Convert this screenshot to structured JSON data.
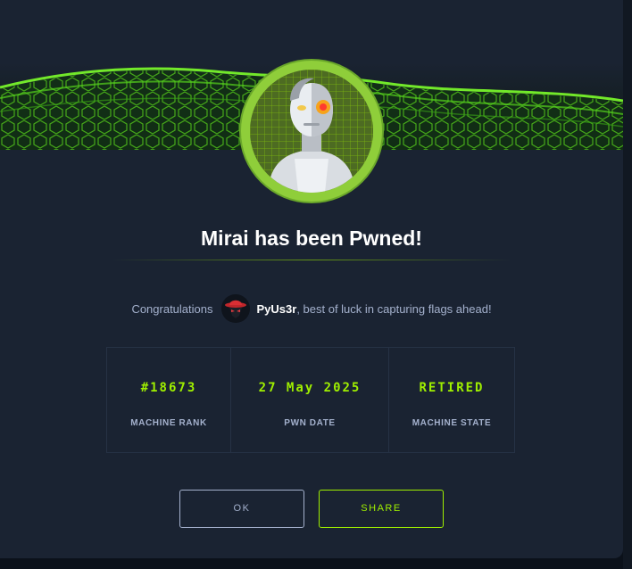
{
  "modal": {
    "title": "Mirai has been Pwned!",
    "congrats_prefix": "Congratulations",
    "username": "PyUs3r",
    "congrats_suffix": ", best of luck in capturing flags ahead!"
  },
  "stats": [
    {
      "value": "#18673",
      "label": "MACHINE RANK"
    },
    {
      "value": "27 May 2025",
      "label": "PWN DATE"
    },
    {
      "value": "RETIRED",
      "label": "MACHINE STATE"
    }
  ],
  "buttons": {
    "ok_label": "OK",
    "share_label": "SHARE"
  },
  "colors": {
    "accent": "#9fef00",
    "background": "#1a2332",
    "text_muted": "#a4b1cd"
  },
  "icons": {
    "banner": "green-hex-wave-banner",
    "machine_avatar": "cyborg-machine-avatar",
    "user_avatar": "red-hat-hacker-avatar"
  }
}
